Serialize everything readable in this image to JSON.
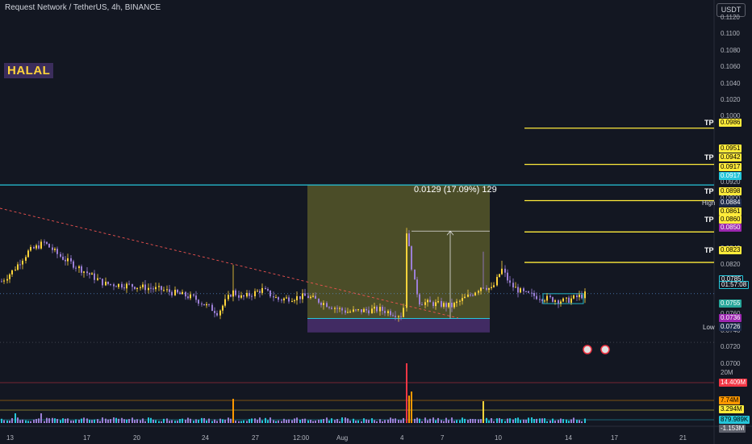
{
  "header": {
    "title": "Request Network / TetherUS, 4h, BINANCE",
    "currency_button": "USDT"
  },
  "annotations": {
    "halal_label": "HALAL",
    "measure_label": "0.0129 (17.09%) 129",
    "tp_label": "TP",
    "high_label": "High",
    "low_label": "Low",
    "volume_scale_label": "20M"
  },
  "colors": {
    "background": "#131722",
    "candle_purple": "#9c7fd6",
    "candle_yellow": "#ffd43b",
    "tp_line": "#ffeb3b",
    "cyan_line": "#26c6da",
    "trendline": "#ef5350",
    "long_box": "#7a7a2e",
    "stop_box": "#4a2f6e"
  },
  "chart_data": {
    "type": "candlestick",
    "symbol": "REQ/USDT",
    "timeframe": "4h",
    "exchange": "BINANCE",
    "y_range": [
      0.069,
      0.112
    ],
    "y_ticks": [
      "0.1120",
      "0.1100",
      "0.1080",
      "0.1060",
      "0.1040",
      "0.1020",
      "0.1000",
      "0.0960",
      "0.0940",
      "0.0920",
      "0.0900",
      "0.0880",
      "0.0840",
      "0.0820",
      "0.0800",
      "0.0760",
      "0.0740",
      "0.0720",
      "0.0700"
    ],
    "x_ticks": [
      "13",
      "17",
      "20",
      "24",
      "27",
      "12:00",
      "Aug",
      "4",
      "7",
      "10",
      "14",
      "17",
      "21"
    ],
    "price_badges": [
      {
        "value": "0.0986",
        "color": "#ffeb3b"
      },
      {
        "value": "0.0951",
        "color": "#ffeb3b"
      },
      {
        "value": "0.0942",
        "color": "#ffeb3b"
      },
      {
        "value": "0.0917",
        "color": "#ffeb3b"
      },
      {
        "value": "0.0917",
        "color": "#26c6da"
      },
      {
        "value": "0.0898",
        "color": "#ffeb3b"
      },
      {
        "value": "0.0884",
        "color": "#1e2b4a"
      },
      {
        "value": "0.0861",
        "color": "#ffeb3b"
      },
      {
        "value": "0.0860",
        "color": "#ffeb3b"
      },
      {
        "value": "0.0850",
        "color": "#9c27b0"
      },
      {
        "value": "0.0823",
        "color": "#ffeb3b"
      },
      {
        "value": "0.0785",
        "color": "#131722"
      },
      {
        "value": "01:57:08",
        "color": "#131722"
      },
      {
        "value": "0.0755",
        "color": "#26a69a"
      },
      {
        "value": "0.0736",
        "color": "#9c27b0"
      },
      {
        "value": "0.0726",
        "color": "#1e2b4a"
      }
    ],
    "take_profit_levels": [
      0.0986,
      0.0942,
      0.0898,
      0.086,
      0.0823
    ],
    "resistance_level": 0.0917,
    "high": 0.0884,
    "low": 0.0726,
    "current_price": 0.0785,
    "countdown": "01:57:08",
    "measure": {
      "change": 0.0129,
      "percent": 17.09,
      "bars": 129
    },
    "volume_badges": [
      {
        "value": "14.409M",
        "color": "#f23645"
      },
      {
        "value": "7.74M",
        "color": "#ff9800"
      },
      {
        "value": "3.294M",
        "color": "#ffeb3b"
      },
      {
        "value": "879.989K",
        "color": "#26c6da"
      },
      {
        "value": "-1.153M",
        "color": "#5d606b"
      }
    ]
  }
}
